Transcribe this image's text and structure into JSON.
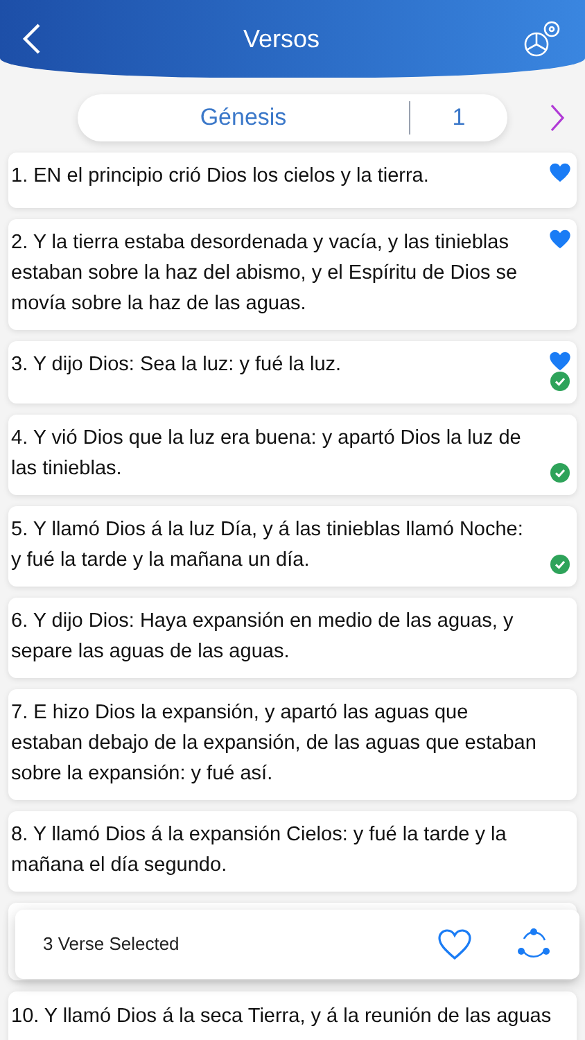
{
  "header": {
    "title": "Versos"
  },
  "selector": {
    "book": "Génesis",
    "chapter": "1"
  },
  "verses": [
    {
      "text": "1. EN el principio crió Dios los cielos y la tierra.",
      "favorite": true,
      "selected": false
    },
    {
      "text": "2. Y la tierra estaba desordenada y vacía, y las tinieblas estaban sobre la haz del abismo, y el Espíritu de Dios se movía sobre la haz de las aguas.",
      "favorite": true,
      "selected": false
    },
    {
      "text": "3. Y dijo Dios: Sea la luz: y fué la luz.",
      "favorite": true,
      "selected": true
    },
    {
      "text": "4. Y vió Dios que la luz era buena: y apartó Dios la luz de las tinieblas.",
      "favorite": false,
      "selected": true
    },
    {
      "text": "5. Y llamó Dios á la luz Día, y á las tinieblas llamó Noche: y fué la tarde y la mañana un día.",
      "favorite": false,
      "selected": true
    },
    {
      "text": "6. Y dijo Dios: Haya expansión en medio de las aguas, y separe las aguas de las aguas.",
      "favorite": false,
      "selected": false
    },
    {
      "text": "7. E hizo Dios la expansión, y apartó las aguas que estaban debajo de la expansión, de las aguas que estaban sobre la expansión: y fué así.",
      "favorite": false,
      "selected": false
    },
    {
      "text": "8. Y llamó Dios á la expansión Cielos: y fué la tarde y la mañana el día segundo.",
      "favorite": false,
      "selected": false
    }
  ],
  "selection_bar": {
    "label": "3 Verse Selected"
  },
  "last_verse": {
    "text": "10. Y llamó Dios á la seca Tierra, y á la reunión de las aguas"
  }
}
